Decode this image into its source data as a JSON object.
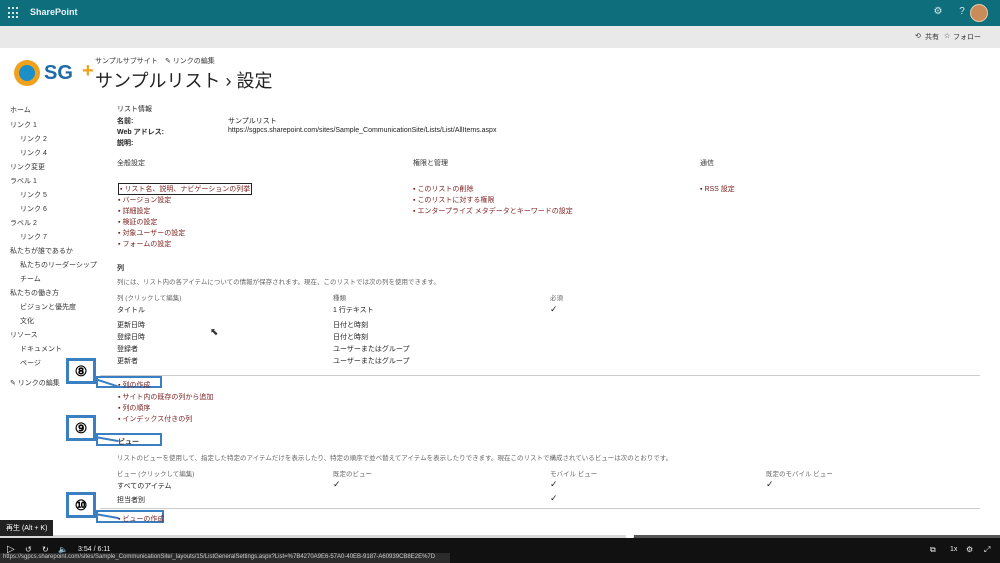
{
  "topbar": {
    "app_name": "SharePoint"
  },
  "commands": {
    "share": "共有",
    "follow": "フォロー"
  },
  "header": {
    "logo_text": "SG",
    "logo_plus": "+",
    "site_name": "サンプルサブサイト",
    "edit_links": "リンクの編集",
    "page_title": "サンプルリスト › 設定"
  },
  "nav": [
    "ホーム",
    "リンク 1",
    "リンク 2",
    "リンク 4",
    "リンク変更",
    "ラベル 1",
    "リンク 5",
    "リンク 6",
    "ラベル 2",
    "リンク 7",
    "私たちが誰であるか",
    "私たちのリーダーシップ",
    "チーム",
    "私たちの働き方",
    "ビジョンと優先度",
    "文化",
    "リソース",
    "ドキュメント",
    "ページ"
  ],
  "nav_edit": "リンクの編集",
  "list_info": {
    "heading": "リスト情報",
    "name_label": "名前:",
    "name_value": "サンプルリスト",
    "web_label": "Web アドレス:",
    "web_value": "https://sgpcs.sharepoint.com/sites/Sample_CommunicationSite/Lists/List/AllItems.aspx",
    "desc_label": "説明:"
  },
  "general": {
    "heading": "全般設定",
    "links": [
      "リスト名、説明、ナビゲーションの列挙",
      "バージョン設定",
      "詳細設定",
      "検証の設定",
      "対象ユーザーの設定",
      "フォームの設定"
    ]
  },
  "permissions": {
    "heading": "権限と管理",
    "links": [
      "このリストの削除",
      "このリストに対する権限",
      "エンタープライズ メタデータとキーワードの設定"
    ]
  },
  "communications": {
    "heading": "通信",
    "links": [
      "RSS 設定"
    ]
  },
  "columns": {
    "heading": "列",
    "description": "列には、リスト内の各アイテムについての情報が保存されます。現在、このリストでは次の列を使用できます。",
    "headers": [
      "列 (クリックして編集)",
      "種類",
      "必須"
    ],
    "rows": [
      {
        "name": "タイトル",
        "type": "1 行テキスト",
        "required": "✓"
      },
      {
        "name": "更新日時",
        "type": "日付と時刻",
        "required": ""
      },
      {
        "name": "登録日時",
        "type": "日付と時刻",
        "required": ""
      },
      {
        "name": "登録者",
        "type": "ユーザーまたはグループ",
        "required": ""
      },
      {
        "name": "更新者",
        "type": "ユーザーまたはグループ",
        "required": ""
      }
    ],
    "links": [
      "列の作成",
      "サイト内の既存の列から追加",
      "列の順序",
      "インデックス付きの列"
    ]
  },
  "views": {
    "heading": "ビュー",
    "description": "リストのビューを使用して、指定した特定のアイテムだけを表示したり、特定の順序で並べ替えてアイテムを表示したりできます。現在このリストで構成されているビューは次のとおりです。",
    "headers": [
      "ビュー (クリックして編集)",
      "既定のビュー",
      "モバイル ビュー",
      "既定のモバイル ビュー"
    ],
    "rows": [
      {
        "name": "すべてのアイテム",
        "default": "✓",
        "mobile": "✓",
        "default_mobile": "✓"
      },
      {
        "name": "担当者別",
        "default": "",
        "mobile": "✓",
        "default_mobile": ""
      }
    ],
    "create": "ビューの作成"
  },
  "callouts": {
    "c8": "⑧",
    "c9": "⑨",
    "c10": "⑩"
  },
  "player": {
    "tooltip": "再生 (Alt + K)",
    "time": "3:54 / 6:11",
    "progress": 0.63,
    "speed": "1x",
    "status_url": "https://sgpcs.sharepoint.com/sites/Sample_CommunicationSite/_layouts/15/ListGeneralSettings.aspx?List=%7B4270A9E6-57A0-40EB-9187-A60939CB8E2E%7D"
  }
}
